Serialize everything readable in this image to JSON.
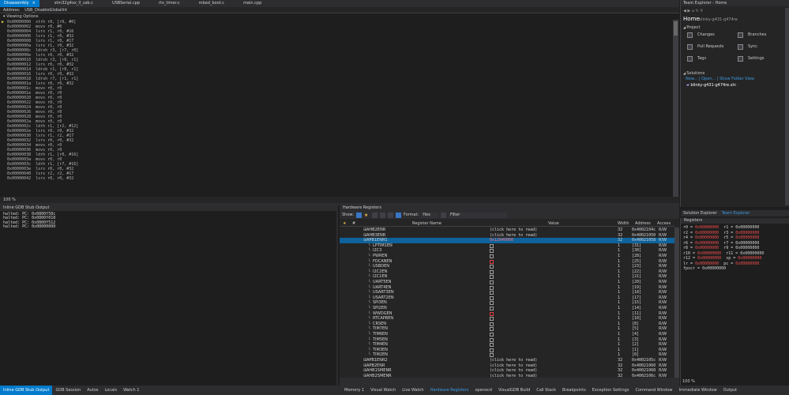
{
  "tabs": [
    {
      "label": "Disassembly",
      "active": true
    },
    {
      "label": "stm32g4xx_ll_usb.c"
    },
    {
      "label": "USBSerial.cpp"
    },
    {
      "label": "rtx_timer.c"
    },
    {
      "label": "mbed_boot.c"
    },
    {
      "label": "main.cpp"
    }
  ],
  "address_bar": {
    "label": "Address:",
    "value": "USB_DisableGlobalInt"
  },
  "viewing_options": "Viewing Options",
  "disassembly": [
    "0x00000000  strh r0, [r0, #0]",
    "0x00000002  movs r0, #0",
    "0x00000004  lsrs r1, r0, #16",
    "0x00000006  lsrs r1, r0, #32",
    "0x00000008  lsrs r1, r0, #17",
    "0x0000000a  lsrs r1, r0, #32",
    "0x0000000c  ldrsh r3, [r7, r0]",
    "0x0000000e  lsrs r0, r0, #32",
    "0x00000010  ldrsh r3, [r0, r1]",
    "0x00000012  lsrs r0, r0, #32",
    "0x00000014  ldrsb r1, [r0, r1]",
    "0x00000016  lsrs r0, r0, #32",
    "0x00000018  ldrsh r7, [r1, r1]",
    "0x0000001a  lsrs r0, r0, #32",
    "0x0000001c  movs r0, r0",
    "0x0000001e  movs r0, r0",
    "0x00000020  movs r0, r0",
    "0x00000022  movs r0, r0",
    "0x00000024  movs r0, r0",
    "0x00000026  movs r0, r0",
    "0x00000028  movs r0, r0",
    "0x0000002a  movs r0, r0",
    "0x0000002c  ldrh r1, [r2, #12]",
    "0x0000002e  lsrs r0, r0, #32",
    "0x00000030  lsrs r1, r2, #17",
    "0x00000032  lsrs r0, r0, #32",
    "0x00000034  movs r0, r0",
    "0x00000036  movs r0, r0",
    "0x00000038  ldrh r1, [r0, #16]",
    "0x0000003a  movs r0, r0",
    "0x0000003c  ldrh r1, [r7, #16]",
    "0x0000003e  lsrs r0, r0, #32",
    "0x00000040  lsrs r2, r2, #17",
    "0x00000042  lsrs r0, r0, #32"
  ],
  "zoom1": "100 %",
  "gdb_panel": {
    "title": "Inline GDB Stub Output",
    "lines": [
      "halted: PC: 0x0800f58c",
      "halted: PC: 0x0800f018",
      "halted: PC: 0x0800f512",
      "halted: PC: 0x08000000"
    ]
  },
  "hw_panel": {
    "title": "Hardware Registers",
    "show_label": "Show:",
    "format_label": "Format:",
    "format_value": "Hex",
    "filter_label": "Filter",
    "columns": {
      "name": "Register Name",
      "value": "Value",
      "width": "Width",
      "address": "Address",
      "access": "Access"
    },
    "rows": [
      {
        "name": "AHB2ENR",
        "value": "(click here to read)",
        "width": "32",
        "address": "0x4002104c",
        "access": "R/W"
      },
      {
        "name": "AHB3ENR",
        "value": "(click here to read)",
        "width": "32",
        "address": "0x40021050",
        "access": "R/W"
      },
      {
        "name": "APB1ENR1",
        "value": "0x12040000",
        "width": "32",
        "address": "0x40021058",
        "access": "R/W",
        "sel": true
      },
      {
        "name": "LPTIM1EN",
        "cb": true,
        "width": "1",
        "address": "[31]",
        "access": "R/W"
      },
      {
        "name": "I2C3",
        "cb": true,
        "width": "1",
        "address": "[30]",
        "access": "R/W"
      },
      {
        "name": "PWREN",
        "cb": true,
        "width": "1",
        "address": "[28]",
        "access": "R/W"
      },
      {
        "name": "FDCANEN",
        "cb": true,
        "red": true,
        "width": "1",
        "address": "[25]",
        "access": "R/W"
      },
      {
        "name": "USBDEN",
        "cb": true,
        "width": "1",
        "address": "[23]",
        "access": "R/W"
      },
      {
        "name": "I2C2EN",
        "cb": true,
        "width": "1",
        "address": "[22]",
        "access": "R/W"
      },
      {
        "name": "I2C1EN",
        "cb": true,
        "width": "1",
        "address": "[21]",
        "access": "R/W"
      },
      {
        "name": "UART5EN",
        "cb": true,
        "width": "1",
        "address": "[20]",
        "access": "R/W"
      },
      {
        "name": "UART4EN",
        "cb": true,
        "width": "1",
        "address": "[19]",
        "access": "R/W"
      },
      {
        "name": "USART3EN",
        "cb": true,
        "width": "1",
        "address": "[18]",
        "access": "R/W"
      },
      {
        "name": "USART2EN",
        "cb": true,
        "width": "1",
        "address": "[17]",
        "access": "R/W"
      },
      {
        "name": "SPI3EN",
        "cb": true,
        "width": "1",
        "address": "[15]",
        "access": "R/W"
      },
      {
        "name": "SPI2EN",
        "cb": true,
        "width": "1",
        "address": "[14]",
        "access": "R/W"
      },
      {
        "name": "WWDGEN",
        "cb": true,
        "red": true,
        "width": "1",
        "address": "[11]",
        "access": "R/W"
      },
      {
        "name": "RTCAPBEN",
        "cb": true,
        "width": "1",
        "address": "[10]",
        "access": "R/W"
      },
      {
        "name": "CRSEN",
        "cb": true,
        "width": "1",
        "address": "[8]",
        "access": "R/W"
      },
      {
        "name": "TIM7EN",
        "cb": true,
        "width": "1",
        "address": "[5]",
        "access": "R/W"
      },
      {
        "name": "TIM6EN",
        "cb": true,
        "width": "1",
        "address": "[4]",
        "access": "R/W"
      },
      {
        "name": "TIM5EN",
        "cb": true,
        "width": "1",
        "address": "[3]",
        "access": "R/W"
      },
      {
        "name": "TIM4EN",
        "cb": true,
        "width": "1",
        "address": "[2]",
        "access": "R/W"
      },
      {
        "name": "TIM3EN",
        "cb": true,
        "width": "1",
        "address": "[1]",
        "access": "R/W"
      },
      {
        "name": "TIM2EN",
        "cb": true,
        "width": "1",
        "address": "[0]",
        "access": "R/W"
      },
      {
        "name": "APB1ENR2",
        "value": "(click here to read)",
        "width": "32",
        "address": "0x4002105c",
        "access": "R/W"
      },
      {
        "name": "APB2ENR",
        "value": "(click here to read)",
        "width": "32",
        "address": "0x40021060",
        "access": "R/W"
      },
      {
        "name": "AHB1SMENR",
        "value": "(click here to read)",
        "width": "32",
        "address": "0x40021068",
        "access": "R/W"
      },
      {
        "name": "AHB2SMENR",
        "value": "(click here to read)",
        "width": "32",
        "address": "0x4002106c",
        "access": "R/W"
      }
    ]
  },
  "team_explorer": {
    "title": "Team Explorer - Home",
    "home": "Home",
    "repo": "blinky-g431-g474re",
    "project_label": "Project",
    "items": [
      {
        "label": "Changes",
        "icon": "changes-icon"
      },
      {
        "label": "Branches",
        "icon": "branches-icon"
      },
      {
        "label": "Pull Requests",
        "icon": "pull-requests-icon"
      },
      {
        "label": "Sync",
        "icon": "sync-icon"
      },
      {
        "label": "Tags",
        "icon": "tags-icon"
      },
      {
        "label": "Settings",
        "icon": "settings-icon"
      }
    ],
    "solutions_label": "Solutions",
    "solution_links": "New... | Open... | Show Folder View",
    "solution_file": "blinky-g431-g474re.sln",
    "bottom_tabs": [
      "Solution Explorer",
      "Team Explorer"
    ]
  },
  "registers": {
    "title": "Registers",
    "lines": [
      [
        [
          "r0 = ",
          ""
        ],
        [
          "0x00000000",
          "v"
        ],
        [
          "  r1 = 0x00000000",
          ""
        ]
      ],
      [
        [
          "r2 = ",
          ""
        ],
        [
          "0x00000000",
          "v"
        ],
        [
          "  r3 = ",
          ""
        ],
        [
          "0x00000000",
          "v"
        ]
      ],
      [
        [
          "r4 = ",
          ""
        ],
        [
          "0x00000000",
          "v"
        ],
        [
          "  r5 = ",
          ""
        ],
        [
          "0x00000000",
          "v"
        ]
      ],
      [
        [
          "r6 = ",
          ""
        ],
        [
          "0x00000000",
          "v"
        ],
        [
          "  r7 = 0x00000000",
          ""
        ]
      ],
      [
        [
          "r8 = ",
          ""
        ],
        [
          "0x00000000",
          "v"
        ],
        [
          "  r9 = 0x00000000",
          ""
        ]
      ],
      [
        [
          "r10 = ",
          ""
        ],
        [
          "0x00000000",
          "v"
        ],
        [
          "  r11 = 0x00000000",
          ""
        ]
      ],
      [
        [
          "r12 = ",
          ""
        ],
        [
          "0x00000000",
          "v"
        ],
        [
          "  sp = ",
          ""
        ],
        [
          "0x00000000",
          "v"
        ]
      ],
      [
        [
          "lr = ",
          ""
        ],
        [
          "0x00000000",
          "v"
        ],
        [
          "  pc = ",
          ""
        ],
        [
          "0x00000000",
          "v"
        ]
      ],
      [
        [
          "fpscr = 0x00000000",
          ""
        ]
      ]
    ]
  },
  "zoom2": "100 %",
  "statusbar": {
    "left": [
      {
        "label": "Inline GDB Stub Output",
        "active": true
      },
      {
        "label": "GDB Session"
      },
      {
        "label": "Autos"
      },
      {
        "label": "Locals"
      },
      {
        "label": "Watch 1"
      }
    ],
    "right": [
      {
        "label": "Memory 1"
      },
      {
        "label": "Visual Watch"
      },
      {
        "label": "Live Watch"
      },
      {
        "label": "Hardware Registers",
        "active": true
      },
      {
        "label": "openocd"
      },
      {
        "label": "VisualGDB Build"
      },
      {
        "label": "Call Stack"
      },
      {
        "label": "Breakpoints"
      },
      {
        "label": "Exception Settings"
      },
      {
        "label": "Command Window"
      },
      {
        "label": "Immediate Window"
      },
      {
        "label": "Output"
      }
    ]
  }
}
